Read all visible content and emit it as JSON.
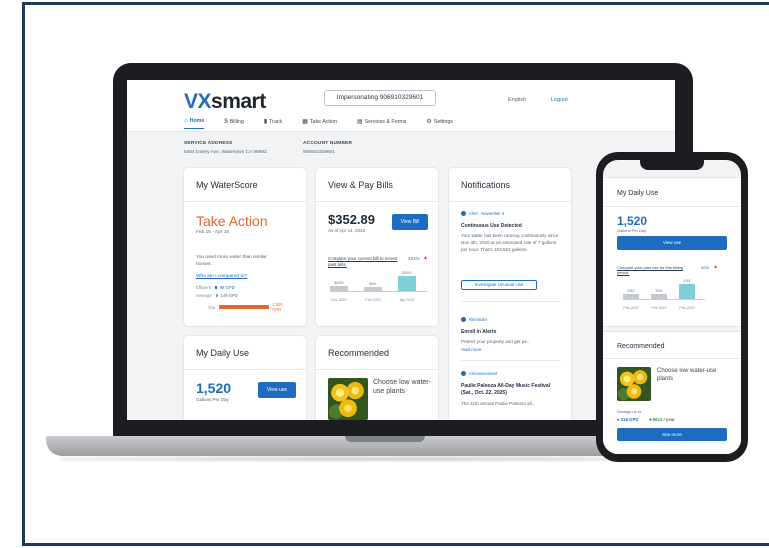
{
  "header": {
    "logo_vx": "VX",
    "logo_smart": "smart",
    "impersonating": "Impersonating 906910329601",
    "language": "English",
    "logout": "Logout"
  },
  "nav": [
    {
      "icon": "home-icon",
      "glyph": "⌂",
      "label": "Home",
      "active": true
    },
    {
      "icon": "dollar-icon",
      "glyph": "$",
      "label": "Billing",
      "active": false
    },
    {
      "icon": "chart-icon",
      "glyph": "▮",
      "label": "Track",
      "active": false
    },
    {
      "icon": "calendar-icon",
      "glyph": "▦",
      "label": "Take Action",
      "active": false
    },
    {
      "icon": "forms-icon",
      "glyph": "▤",
      "label": "Services & Forms",
      "active": false
    },
    {
      "icon": "gear-icon",
      "glyph": "⚙",
      "label": "Settings",
      "active": false
    }
  ],
  "account": {
    "service_label": "SERVICE ADDRESS",
    "service_value": "5404 Dasey Ave, Watertown CA 99992",
    "account_label": "ACCOUNT NUMBER",
    "account_value": "906910329601"
  },
  "waterscore": {
    "title": "My WaterScore",
    "status": "Take Action",
    "dates": "Feb 15 - Apr 15",
    "message": "You used more water than similar homes.",
    "link": "Who am I compared to?",
    "rows": [
      {
        "label": "Efficient",
        "value": "98 GPD",
        "color": "#1e6cc0",
        "fill": 0.06
      },
      {
        "label": "Average",
        "value": "149 GPD",
        "color": "#9aa3ad",
        "fill": 0.06
      },
      {
        "label": "You",
        "value": "1,520 GPD",
        "color": "#e3672e",
        "fill": 1.0
      }
    ]
  },
  "bills": {
    "title": "View & Pay Bills",
    "amount": "$352.89",
    "as_of": "As of Apr 14, 2023",
    "button": "View Bill",
    "compare_link": "Compare your current bill to recent past bills.",
    "percent": "331%",
    "bars": [
      {
        "value_label": "$XXX",
        "x_label": "Dec 2022",
        "color": "#c4c9cf",
        "level": 0.25
      },
      {
        "value_label": "$XX",
        "x_label": "Feb 2023",
        "color": "#c4c9cf",
        "level": 0.2
      },
      {
        "value_label": "$XXX",
        "x_label": "Apr 2023",
        "color": "#7fd0d6",
        "level": 0.75
      }
    ]
  },
  "notifications": {
    "title": "Notifications",
    "items": [
      {
        "tag": "Alert · November 4",
        "heading": "Continuous Use Detected",
        "body": "Your water has been running continuously since Nov 4th, 2020 at an estimated rate of 7 gallons per hour. That's 163,553 gallons.",
        "action": "Investigate Unusual Use"
      },
      {
        "tag": "Reminder",
        "heading": "Enroll in Alerts",
        "body": "Protect your property and get pe...",
        "more": "read more"
      },
      {
        "tag": "Announcement",
        "heading": "Paulie Palooza All-Day Music Festival (Sat., Oct. 22, 2025)",
        "body": "The 11th annual Paulie Palooza all..."
      }
    ]
  },
  "daily_use": {
    "title": "My Daily Use",
    "value": "1,520",
    "unit": "Gallons Per Day",
    "button": "View use"
  },
  "recommended": {
    "title": "Recommended",
    "text": "Choose low water-use plants"
  },
  "phone": {
    "daily_title": "My Daily Use",
    "daily_value": "1,520",
    "daily_unit": "Gallons Per Day",
    "daily_button": "View use",
    "compare_link": "Compare your past use for this billing period.",
    "percent": "90%",
    "bars": [
      {
        "value_label": "XXX",
        "x_label": "Feb 2022",
        "color": "#c4c9cf",
        "level": 0.3
      },
      {
        "value_label": "XXX",
        "x_label": "Feb 2023",
        "color": "#c4c9cf",
        "level": 0.3
      },
      {
        "value_label": "XXX",
        "x_label": "Feb 2023",
        "color": "#7fd0d6",
        "level": 0.85
      }
    ],
    "rec_title": "Recommended",
    "rec_text": "Choose low water-use plants",
    "savings_label": "Savings up to",
    "savings_gpd": "218 GPD",
    "savings_cost": "$612 / year",
    "see_more": "See more"
  }
}
